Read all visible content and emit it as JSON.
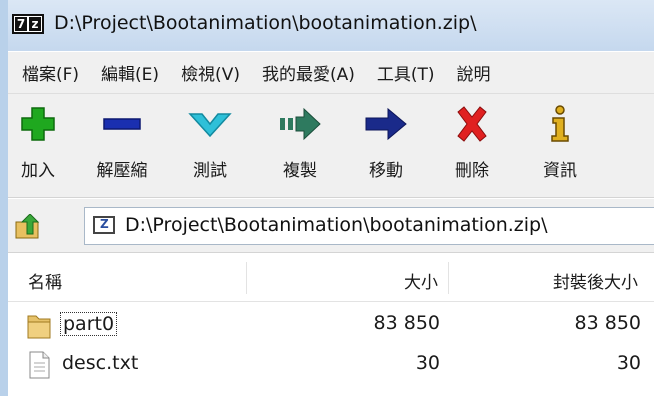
{
  "window": {
    "title": "D:\\Project\\Bootanimation\\bootanimation.zip\\"
  },
  "app_icon": {
    "left": "7",
    "right": "z"
  },
  "menu": [
    "檔案(F)",
    "編輯(E)",
    "檢視(V)",
    "我的最愛(A)",
    "工具(T)",
    "說明"
  ],
  "toolbar": [
    {
      "label": "加入",
      "icon": "add-icon"
    },
    {
      "label": "解壓縮",
      "icon": "extract-icon"
    },
    {
      "label": "測試",
      "icon": "test-icon"
    },
    {
      "label": "複製",
      "icon": "copy-icon"
    },
    {
      "label": "移動",
      "icon": "move-icon"
    },
    {
      "label": "刪除",
      "icon": "delete-icon"
    },
    {
      "label": "資訊",
      "icon": "info-icon"
    }
  ],
  "address": {
    "path": "D:\\Project\\Bootanimation\\bootanimation.zip\\"
  },
  "columns": {
    "name": "名稱",
    "size": "大小",
    "packed": "封裝後大小"
  },
  "files": [
    {
      "name": "part0",
      "size": "83 850",
      "packed": "83 850",
      "type": "folder"
    },
    {
      "name": "desc.txt",
      "size": "30",
      "packed": "30",
      "type": "file"
    }
  ],
  "colors": {
    "add": "#1fa81f",
    "extract": "#1a2fb0",
    "test": "#2ec0d8",
    "copy": "#2e7a5f",
    "move": "#1a2a8a",
    "delete": "#e02020",
    "info": "#e0b020"
  }
}
